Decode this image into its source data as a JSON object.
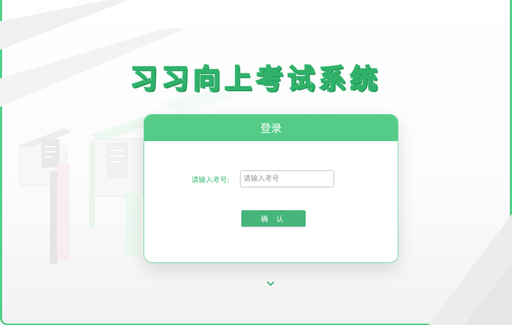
{
  "app_title": "习习向上考试系统",
  "login_card": {
    "header": "登录",
    "exam_number_label": "请输入考号:",
    "exam_number_value": "",
    "exam_number_placeholder": "请输入考号",
    "confirm_label": "确 认"
  },
  "colors": {
    "accent": "#54cc88",
    "button": "#46b57a",
    "label": "#3fbf78",
    "frame": "#4fcf87"
  },
  "icons": {
    "scroll_hint": "chevron-down-icon"
  }
}
